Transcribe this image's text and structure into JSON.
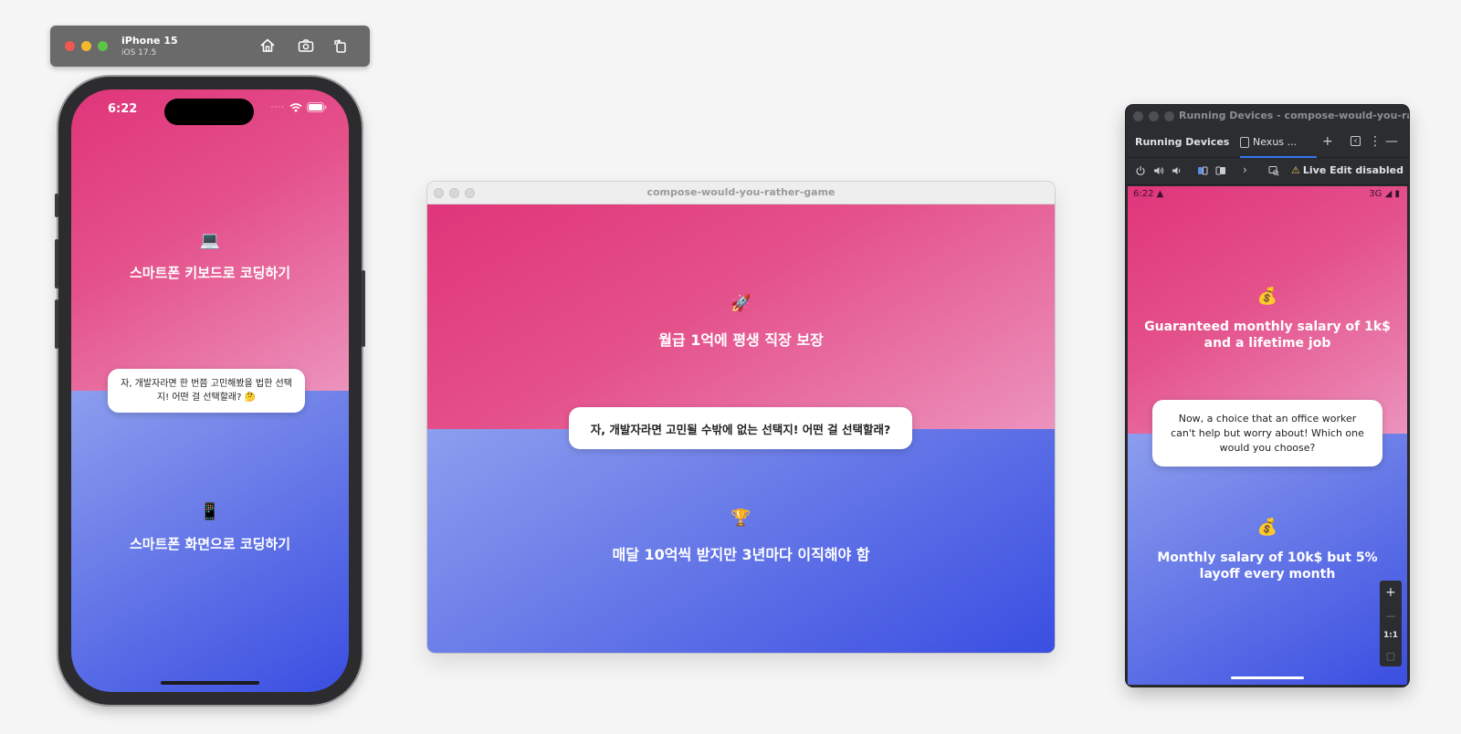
{
  "ios_simulator": {
    "device_name": "iPhone 15",
    "os_version": "iOS 17.5",
    "toolbar_icons": [
      "home-icon",
      "screenshot-icon",
      "rotate-icon"
    ],
    "status_time": "6:22",
    "game": {
      "option_a": {
        "emoji": "💻",
        "text": "스마트폰 키보드로 코딩하기"
      },
      "question": "자, 개발자라면 한 번쯤 고민해봤을 법한 선택지! 어떤 걸 선택할래? 🤔",
      "option_b": {
        "emoji": "📱",
        "text": "스마트폰 화면으로 코딩하기"
      }
    }
  },
  "desktop_window": {
    "title": "compose-would-you-rather-game",
    "game": {
      "option_a": {
        "emoji": "🚀",
        "text": "월급 1억에 평생 직장 보장"
      },
      "question": "자, 개발자라면 고민될 수밖에 없는 선택지! 어떤 걸 선택할래?",
      "option_b": {
        "emoji": "🏆",
        "text": "매달 10억씩 받지만 3년마다 이직해야 함"
      }
    }
  },
  "android_studio": {
    "window_title": "Running Devices - compose-would-you-rat...",
    "panel_label": "Running Devices",
    "device_tab": "Nexus ...",
    "live_edit": "Live Edit disabled",
    "status_time": "6:22",
    "status_network": "3G",
    "zoom_label": "1:1",
    "game": {
      "option_a": {
        "emoji": "💰",
        "text": "Guaranteed monthly salary of 1k$ and a lifetime job"
      },
      "question": "Now, a choice that an office worker can't help but worry about! Which one would you choose?",
      "option_b": {
        "emoji": "💰",
        "text": "Monthly salary of 10k$ but 5% layoff every month"
      }
    }
  },
  "colors": {
    "pink_top": "#e0357a",
    "pink_light": "#ec93bd",
    "blue_light": "#8c9eee",
    "blue_deep": "#3a4ee2",
    "android_ui": "#2b2d30"
  }
}
